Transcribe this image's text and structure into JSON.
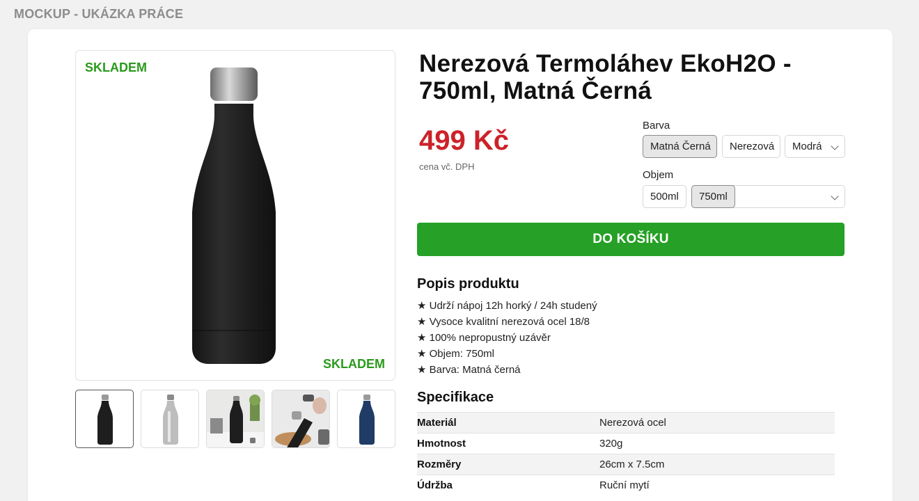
{
  "mockup_label": "MOCKUP - UKÁZKA PRÁCE",
  "product": {
    "title": "Nerezová Termoláhev EkoH2O - 750ml, Matná Černá",
    "stock_top": "SKLADEM",
    "stock_bottom": "SKLADEM",
    "price": "499 Kč",
    "price_note": "cena vč. DPH"
  },
  "thumbnails": [
    {
      "name": "black-bottle",
      "color": "#1e1e1e"
    },
    {
      "name": "steel-bottle",
      "color": "#b5b5b5"
    },
    {
      "name": "lifestyle-bottle",
      "color": "#1e1e1e"
    },
    {
      "name": "pouring-bottle",
      "color": "#1e1e1e"
    },
    {
      "name": "blue-bottle",
      "color": "#1f3b66"
    }
  ],
  "options": {
    "color_label": "Barva",
    "color_values": [
      "Matná Černá",
      "Nerezová",
      "Modrá"
    ],
    "color_selected": "Matná Černá",
    "volume_label": "Objem",
    "volume_values": [
      "500ml",
      "750ml"
    ],
    "volume_selected": "750ml"
  },
  "cart_button": "DO KOŠÍKU",
  "description": {
    "heading": "Popis produktu",
    "items": [
      "★ Udrží nápoj 12h horký / 24h studený",
      "★ Vysoce kvalitní nerezová ocel 18/8",
      "★ 100% nepropustný uzávěr",
      "★ Objem: 750ml",
      "★ Barva: Matná černá"
    ]
  },
  "specs": {
    "heading": "Specifikace",
    "rows": [
      {
        "key": "Materiál",
        "value": "Nerezová ocel"
      },
      {
        "key": "Hmotnost",
        "value": "320g"
      },
      {
        "key": "Rozměry",
        "value": "26cm x 7.5cm"
      },
      {
        "key": "Údržba",
        "value": "Ruční mytí"
      }
    ]
  },
  "colors": {
    "accent_green": "#26a026",
    "stock_green": "#2a9a1d",
    "price_red": "#cc2229"
  }
}
